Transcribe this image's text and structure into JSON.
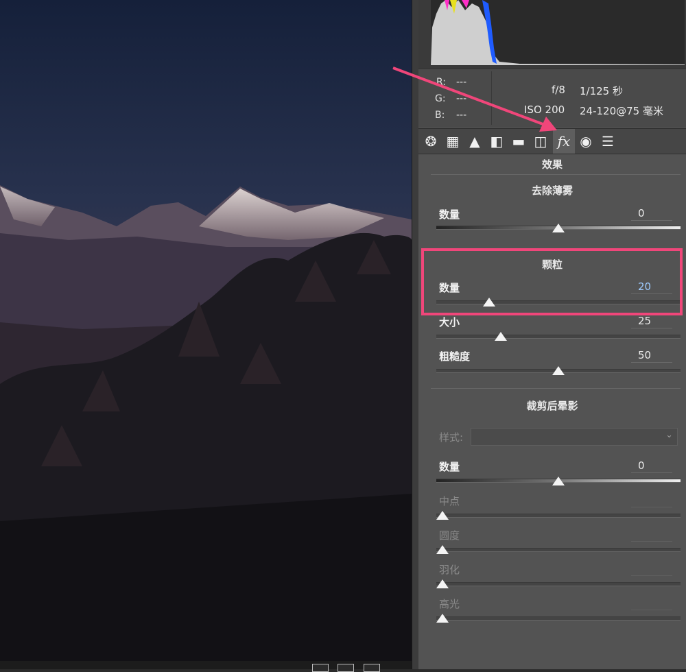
{
  "colors": {
    "accent_highlight": "#f0467a",
    "panel_bg": "#535353",
    "text": "#e6e6e6"
  },
  "info": {
    "r": "R:",
    "r_val": "---",
    "g": "G:",
    "g_val": "---",
    "b": "B:",
    "b_val": "---",
    "aperture": "f/8",
    "shutter": "1/125 秒",
    "iso": "ISO 200",
    "lens": "24-120@75 毫米"
  },
  "toolbar": {
    "tools": [
      {
        "name": "aperture-icon",
        "glyph": "❂"
      },
      {
        "name": "grid-icon",
        "glyph": "▦"
      },
      {
        "name": "mountain-icon",
        "glyph": "▲"
      },
      {
        "name": "split-tone-icon",
        "glyph": "◧"
      },
      {
        "name": "detail-icon",
        "glyph": "▬"
      },
      {
        "name": "lens-icon",
        "glyph": "◫"
      },
      {
        "name": "fx-icon",
        "glyph": "fx"
      },
      {
        "name": "camera-icon",
        "glyph": "◉"
      },
      {
        "name": "sliders-icon",
        "glyph": "☰"
      }
    ],
    "active_index": 6
  },
  "panel": {
    "title": "效果",
    "dehaze": {
      "title": "去除薄雾",
      "amount_label": "数量",
      "amount_value": "0",
      "amount_pos": 0.5
    },
    "grain": {
      "title": "颗粒",
      "amount_label": "数量",
      "amount_value": "20",
      "amount_pos": 0.2,
      "size_label": "大小",
      "size_value": "25",
      "size_pos": 0.25,
      "roughness_label": "粗糙度",
      "roughness_value": "50",
      "roughness_pos": 0.5
    },
    "vignette": {
      "title": "裁剪后晕影",
      "style_label": "样式:",
      "amount_label": "数量",
      "amount_value": "0",
      "amount_pos": 0.5,
      "midpoint_label": "中点",
      "midpoint_pos": 0,
      "roundness_label": "圆度",
      "roundness_pos": 0,
      "feather_label": "羽化",
      "feather_pos": 0,
      "highlights_label": "高光",
      "highlights_pos": 0
    }
  }
}
